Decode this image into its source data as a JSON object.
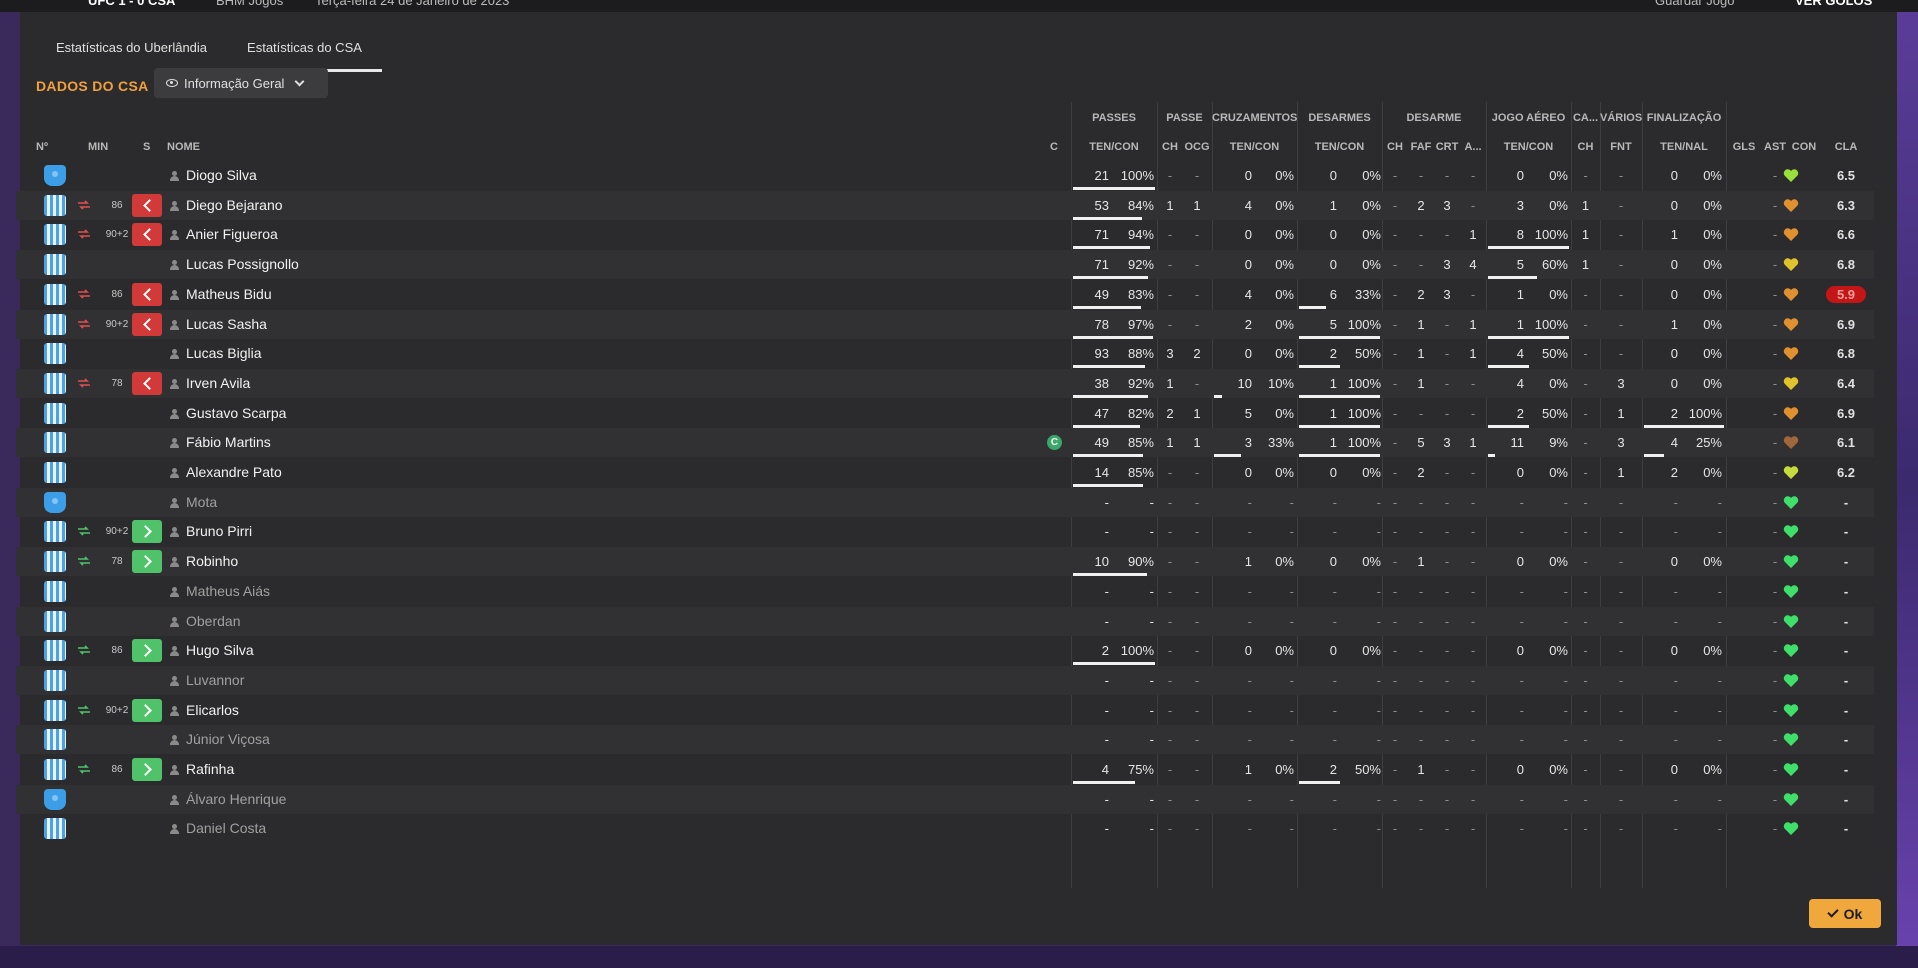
{
  "topbar": {
    "score": "UFC  1 - 0  CSA",
    "channel": "BHM Jogos",
    "date": "Terça-feira 24 de Janeiro de 2023",
    "save_label": "Guardar Jogo",
    "goals_label": "VER GOLOS"
  },
  "tabs": [
    {
      "label": "Estatísticas do Uberlândia",
      "active": false
    },
    {
      "label": "Estatísticas do CSA",
      "active": true
    }
  ],
  "team_title": "DADOS DO CSA",
  "view_dropdown": {
    "selected": "Informação Geral"
  },
  "groups": {
    "passes": "PASSES",
    "passe": "PASSE",
    "cruzamentos": "CRUZAMENTOS",
    "desarmes": "DESARMES",
    "desarme": "DESARME",
    "jogo_aereo": "JOGO AÉREO",
    "ca": "CA...",
    "varios": "VÁRIOS",
    "finalizacao": "FINALIZAÇÃO"
  },
  "subheaders": {
    "num": "Nº",
    "min": "MIN",
    "s": "S",
    "nome": "NOME",
    "c": "C",
    "passes": "TEN/CON",
    "passe_ch": "CH",
    "passe_ocg": "OCG",
    "cruz": "TEN/CON",
    "des": "TEN/CON",
    "desarme_ch": "CH",
    "faf": "FAF",
    "crt": "CRT",
    "a": "A...",
    "aereo": "TEN/CON",
    "ca_ch": "CH",
    "fnt": "FNT",
    "fin": "TEN/NAL",
    "gls": "GLS",
    "ast": "AST",
    "con": "CON",
    "cla": "CLA"
  },
  "colors": {
    "accent": "#f0a03c",
    "sub_out": "#d23a3a",
    "sub_in": "#4fc26a",
    "bad_rating": "#c41616"
  },
  "players": [
    {
      "kit": "gk",
      "min": "",
      "sub": "",
      "name": "Diogo Silva",
      "unused": false,
      "captain": false,
      "p": [
        "21",
        "100%"
      ],
      "pa": [
        "-",
        "-"
      ],
      "cr": [
        "0",
        "0%"
      ],
      "de": [
        "0",
        "0%"
      ],
      "ds": [
        "-",
        "-",
        "-",
        "-"
      ],
      "ae": [
        "0",
        "0%"
      ],
      "ca": "-",
      "fnt": "-",
      "fi": [
        "0",
        "0%"
      ],
      "gls": "",
      "ast": "-",
      "con": "green-yellow",
      "cla": "6.5",
      "bad": false,
      "bars": {
        "p": 1.0
      }
    },
    {
      "kit": "field",
      "min": "86",
      "sub": "out",
      "name": "Diego Bejarano",
      "unused": false,
      "captain": false,
      "p": [
        "53",
        "84%"
      ],
      "pa": [
        "1",
        "1"
      ],
      "cr": [
        "4",
        "0%"
      ],
      "de": [
        "1",
        "0%"
      ],
      "ds": [
        "-",
        "2",
        "3",
        "-"
      ],
      "ae": [
        "3",
        "0%"
      ],
      "ca": "1",
      "fnt": "-",
      "fi": [
        "0",
        "0%"
      ],
      "gls": "",
      "ast": "-",
      "con": "orange",
      "cla": "6.3",
      "bad": false,
      "bars": {
        "p": 0.84
      }
    },
    {
      "kit": "field",
      "min": "90+2",
      "sub": "out",
      "name": "Anier Figueroa",
      "unused": false,
      "captain": false,
      "p": [
        "71",
        "94%"
      ],
      "pa": [
        "-",
        "-"
      ],
      "cr": [
        "0",
        "0%"
      ],
      "de": [
        "0",
        "0%"
      ],
      "ds": [
        "-",
        "-",
        "-",
        "1"
      ],
      "ae": [
        "8",
        "100%"
      ],
      "ca": "1",
      "fnt": "-",
      "fi": [
        "1",
        "0%"
      ],
      "gls": "",
      "ast": "-",
      "con": "orange",
      "cla": "6.6",
      "bad": false,
      "bars": {
        "p": 0.94,
        "ae": 1.0
      }
    },
    {
      "kit": "field",
      "min": "",
      "sub": "",
      "name": "Lucas Possignollo",
      "unused": false,
      "captain": false,
      "p": [
        "71",
        "92%"
      ],
      "pa": [
        "-",
        "-"
      ],
      "cr": [
        "0",
        "0%"
      ],
      "de": [
        "0",
        "0%"
      ],
      "ds": [
        "-",
        "-",
        "3",
        "4"
      ],
      "ae": [
        "5",
        "60%"
      ],
      "ca": "1",
      "fnt": "-",
      "fi": [
        "0",
        "0%"
      ],
      "gls": "",
      "ast": "-",
      "con": "yellow",
      "cla": "6.8",
      "bad": false,
      "bars": {
        "p": 0.92,
        "ae": 0.6
      }
    },
    {
      "kit": "field",
      "min": "86",
      "sub": "out",
      "name": "Matheus Bidu",
      "unused": false,
      "captain": false,
      "p": [
        "49",
        "83%"
      ],
      "pa": [
        "-",
        "-"
      ],
      "cr": [
        "4",
        "0%"
      ],
      "de": [
        "6",
        "33%"
      ],
      "ds": [
        "-",
        "2",
        "3",
        "-"
      ],
      "ae": [
        "1",
        "0%"
      ],
      "ca": "-",
      "fnt": "-",
      "fi": [
        "0",
        "0%"
      ],
      "gls": "",
      "ast": "-",
      "con": "orange",
      "cla": "5.9",
      "bad": true,
      "bars": {
        "p": 0.83,
        "de": 0.33
      }
    },
    {
      "kit": "field",
      "min": "90+2",
      "sub": "out",
      "name": "Lucas Sasha",
      "unused": false,
      "captain": false,
      "p": [
        "78",
        "97%"
      ],
      "pa": [
        "-",
        "-"
      ],
      "cr": [
        "2",
        "0%"
      ],
      "de": [
        "5",
        "100%"
      ],
      "ds": [
        "-",
        "1",
        "-",
        "1"
      ],
      "ae": [
        "1",
        "100%"
      ],
      "ca": "-",
      "fnt": "-",
      "fi": [
        "1",
        "0%"
      ],
      "gls": "",
      "ast": "-",
      "con": "orange",
      "cla": "6.9",
      "bad": false,
      "bars": {
        "p": 0.97,
        "de": 1.0,
        "ae": 1.0
      }
    },
    {
      "kit": "field",
      "min": "",
      "sub": "",
      "name": "Lucas Biglia",
      "unused": false,
      "captain": false,
      "p": [
        "93",
        "88%"
      ],
      "pa": [
        "3",
        "2"
      ],
      "cr": [
        "0",
        "0%"
      ],
      "de": [
        "2",
        "50%"
      ],
      "ds": [
        "-",
        "1",
        "-",
        "1"
      ],
      "ae": [
        "4",
        "50%"
      ],
      "ca": "-",
      "fnt": "-",
      "fi": [
        "0",
        "0%"
      ],
      "gls": "",
      "ast": "-",
      "con": "orange",
      "cla": "6.8",
      "bad": false,
      "bars": {
        "p": 0.88,
        "de": 0.5,
        "ae": 0.5
      }
    },
    {
      "kit": "field",
      "min": "78",
      "sub": "out",
      "name": "Irven Avila",
      "unused": false,
      "captain": false,
      "p": [
        "38",
        "92%"
      ],
      "pa": [
        "1",
        "-"
      ],
      "cr": [
        "10",
        "10%"
      ],
      "de": [
        "1",
        "100%"
      ],
      "ds": [
        "-",
        "1",
        "-",
        "-"
      ],
      "ae": [
        "4",
        "0%"
      ],
      "ca": "-",
      "fnt": "3",
      "fi": [
        "0",
        "0%"
      ],
      "gls": "",
      "ast": "-",
      "con": "yellow",
      "cla": "6.4",
      "bad": false,
      "bars": {
        "p": 0.92,
        "cr": 0.1,
        "de": 1.0
      }
    },
    {
      "kit": "field",
      "min": "",
      "sub": "",
      "name": "Gustavo Scarpa",
      "unused": false,
      "captain": false,
      "p": [
        "47",
        "82%"
      ],
      "pa": [
        "2",
        "1"
      ],
      "cr": [
        "5",
        "0%"
      ],
      "de": [
        "1",
        "100%"
      ],
      "ds": [
        "-",
        "-",
        "-",
        "-"
      ],
      "ae": [
        "2",
        "50%"
      ],
      "ca": "-",
      "fnt": "1",
      "fi": [
        "2",
        "100%"
      ],
      "gls": "",
      "ast": "-",
      "con": "orange",
      "cla": "6.9",
      "bad": false,
      "bars": {
        "p": 0.82,
        "de": 1.0,
        "ae": 0.5,
        "fi": 1.0
      }
    },
    {
      "kit": "field",
      "min": "",
      "sub": "",
      "name": "Fábio Martins",
      "unused": false,
      "captain": true,
      "p": [
        "49",
        "85%"
      ],
      "pa": [
        "1",
        "1"
      ],
      "cr": [
        "3",
        "33%"
      ],
      "de": [
        "1",
        "100%"
      ],
      "ds": [
        "-",
        "5",
        "3",
        "1"
      ],
      "ae": [
        "11",
        "9%"
      ],
      "ca": "-",
      "fnt": "3",
      "fi": [
        "4",
        "25%"
      ],
      "gls": "",
      "ast": "-",
      "con": "brown",
      "cla": "6.1",
      "bad": false,
      "bars": {
        "p": 0.85,
        "cr": 0.33,
        "de": 1.0,
        "ae": 0.09,
        "fi": 0.25
      }
    },
    {
      "kit": "field",
      "min": "",
      "sub": "",
      "name": "Alexandre Pato",
      "unused": false,
      "captain": false,
      "p": [
        "14",
        "85%"
      ],
      "pa": [
        "-",
        "-"
      ],
      "cr": [
        "0",
        "0%"
      ],
      "de": [
        "0",
        "0%"
      ],
      "ds": [
        "-",
        "2",
        "-",
        "-"
      ],
      "ae": [
        "0",
        "0%"
      ],
      "ca": "-",
      "fnt": "1",
      "fi": [
        "2",
        "0%"
      ],
      "gls": "",
      "ast": "-",
      "con": "yellow-green",
      "cla": "6.2",
      "bad": false,
      "bars": {
        "p": 0.85
      }
    },
    {
      "kit": "gk",
      "min": "",
      "sub": "",
      "name": "Mota",
      "unused": true,
      "captain": false,
      "p": [
        "-",
        "-"
      ],
      "pa": [
        "-",
        "-"
      ],
      "cr": [
        "-",
        "-"
      ],
      "de": [
        "-",
        "-"
      ],
      "ds": [
        "-",
        "-",
        "-",
        "-"
      ],
      "ae": [
        "-",
        "-"
      ],
      "ca": "-",
      "fnt": "-",
      "fi": [
        "-",
        "-"
      ],
      "gls": "",
      "ast": "-",
      "con": "green",
      "cla": "-",
      "bad": false,
      "bars": {}
    },
    {
      "kit": "field",
      "min": "90+2",
      "sub": "in",
      "name": "Bruno Pirri",
      "unused": false,
      "captain": false,
      "p": [
        "-",
        "-"
      ],
      "pa": [
        "-",
        "-"
      ],
      "cr": [
        "-",
        "-"
      ],
      "de": [
        "-",
        "-"
      ],
      "ds": [
        "-",
        "-",
        "-",
        "-"
      ],
      "ae": [
        "-",
        "-"
      ],
      "ca": "-",
      "fnt": "-",
      "fi": [
        "-",
        "-"
      ],
      "gls": "",
      "ast": "-",
      "con": "green",
      "cla": "-",
      "bad": false,
      "bars": {}
    },
    {
      "kit": "field",
      "min": "78",
      "sub": "in",
      "name": "Robinho",
      "unused": false,
      "captain": false,
      "p": [
        "10",
        "90%"
      ],
      "pa": [
        "-",
        "-"
      ],
      "cr": [
        "1",
        "0%"
      ],
      "de": [
        "0",
        "0%"
      ],
      "ds": [
        "-",
        "1",
        "-",
        "-"
      ],
      "ae": [
        "0",
        "0%"
      ],
      "ca": "-",
      "fnt": "-",
      "fi": [
        "0",
        "0%"
      ],
      "gls": "",
      "ast": "-",
      "con": "green",
      "cla": "-",
      "bad": false,
      "bars": {
        "p": 0.9
      }
    },
    {
      "kit": "field",
      "min": "",
      "sub": "",
      "name": "Matheus Aiás",
      "unused": true,
      "captain": false,
      "p": [
        "-",
        "-"
      ],
      "pa": [
        "-",
        "-"
      ],
      "cr": [
        "-",
        "-"
      ],
      "de": [
        "-",
        "-"
      ],
      "ds": [
        "-",
        "-",
        "-",
        "-"
      ],
      "ae": [
        "-",
        "-"
      ],
      "ca": "-",
      "fnt": "-",
      "fi": [
        "-",
        "-"
      ],
      "gls": "",
      "ast": "-",
      "con": "green",
      "cla": "-",
      "bad": false,
      "bars": {}
    },
    {
      "kit": "field",
      "min": "",
      "sub": "",
      "name": "Oberdan",
      "unused": true,
      "captain": false,
      "p": [
        "-",
        "-"
      ],
      "pa": [
        "-",
        "-"
      ],
      "cr": [
        "-",
        "-"
      ],
      "de": [
        "-",
        "-"
      ],
      "ds": [
        "-",
        "-",
        "-",
        "-"
      ],
      "ae": [
        "-",
        "-"
      ],
      "ca": "-",
      "fnt": "-",
      "fi": [
        "-",
        "-"
      ],
      "gls": "",
      "ast": "-",
      "con": "green",
      "cla": "-",
      "bad": false,
      "bars": {}
    },
    {
      "kit": "field",
      "min": "86",
      "sub": "in",
      "name": "Hugo Silva",
      "unused": false,
      "captain": false,
      "p": [
        "2",
        "100%"
      ],
      "pa": [
        "-",
        "-"
      ],
      "cr": [
        "0",
        "0%"
      ],
      "de": [
        "0",
        "0%"
      ],
      "ds": [
        "-",
        "-",
        "-",
        "-"
      ],
      "ae": [
        "0",
        "0%"
      ],
      "ca": "-",
      "fnt": "-",
      "fi": [
        "0",
        "0%"
      ],
      "gls": "",
      "ast": "-",
      "con": "green",
      "cla": "-",
      "bad": false,
      "bars": {
        "p": 1.0
      }
    },
    {
      "kit": "field",
      "min": "",
      "sub": "",
      "name": "Luvannor",
      "unused": true,
      "captain": false,
      "p": [
        "-",
        "-"
      ],
      "pa": [
        "-",
        "-"
      ],
      "cr": [
        "-",
        "-"
      ],
      "de": [
        "-",
        "-"
      ],
      "ds": [
        "-",
        "-",
        "-",
        "-"
      ],
      "ae": [
        "-",
        "-"
      ],
      "ca": "-",
      "fnt": "-",
      "fi": [
        "-",
        "-"
      ],
      "gls": "",
      "ast": "-",
      "con": "green",
      "cla": "-",
      "bad": false,
      "bars": {}
    },
    {
      "kit": "field",
      "min": "90+2",
      "sub": "in",
      "name": "Elicarlos",
      "unused": false,
      "captain": false,
      "p": [
        "-",
        "-"
      ],
      "pa": [
        "-",
        "-"
      ],
      "cr": [
        "-",
        "-"
      ],
      "de": [
        "-",
        "-"
      ],
      "ds": [
        "-",
        "-",
        "-",
        "-"
      ],
      "ae": [
        "-",
        "-"
      ],
      "ca": "-",
      "fnt": "-",
      "fi": [
        "-",
        "-"
      ],
      "gls": "",
      "ast": "-",
      "con": "green",
      "cla": "-",
      "bad": false,
      "bars": {}
    },
    {
      "kit": "field",
      "min": "",
      "sub": "",
      "name": "Júnior Viçosa",
      "unused": true,
      "captain": false,
      "p": [
        "-",
        "-"
      ],
      "pa": [
        "-",
        "-"
      ],
      "cr": [
        "-",
        "-"
      ],
      "de": [
        "-",
        "-"
      ],
      "ds": [
        "-",
        "-",
        "-",
        "-"
      ],
      "ae": [
        "-",
        "-"
      ],
      "ca": "-",
      "fnt": "-",
      "fi": [
        "-",
        "-"
      ],
      "gls": "",
      "ast": "-",
      "con": "green",
      "cla": "-",
      "bad": false,
      "bars": {}
    },
    {
      "kit": "field",
      "min": "86",
      "sub": "in",
      "name": "Rafinha",
      "unused": false,
      "captain": false,
      "p": [
        "4",
        "75%"
      ],
      "pa": [
        "-",
        "-"
      ],
      "cr": [
        "1",
        "0%"
      ],
      "de": [
        "2",
        "50%"
      ],
      "ds": [
        "-",
        "1",
        "-",
        "-"
      ],
      "ae": [
        "0",
        "0%"
      ],
      "ca": "-",
      "fnt": "-",
      "fi": [
        "0",
        "0%"
      ],
      "gls": "",
      "ast": "-",
      "con": "green",
      "cla": "-",
      "bad": false,
      "bars": {
        "p": 0.75,
        "de": 0.5
      }
    },
    {
      "kit": "gk",
      "min": "",
      "sub": "",
      "name": "Álvaro Henrique",
      "unused": true,
      "captain": false,
      "p": [
        "-",
        "-"
      ],
      "pa": [
        "-",
        "-"
      ],
      "cr": [
        "-",
        "-"
      ],
      "de": [
        "-",
        "-"
      ],
      "ds": [
        "-",
        "-",
        "-",
        "-"
      ],
      "ae": [
        "-",
        "-"
      ],
      "ca": "-",
      "fnt": "-",
      "fi": [
        "-",
        "-"
      ],
      "gls": "",
      "ast": "-",
      "con": "green",
      "cla": "-",
      "bad": false,
      "bars": {}
    },
    {
      "kit": "field",
      "min": "",
      "sub": "",
      "name": "Daniel Costa",
      "unused": true,
      "captain": false,
      "p": [
        "-",
        "-"
      ],
      "pa": [
        "-",
        "-"
      ],
      "cr": [
        "-",
        "-"
      ],
      "de": [
        "-",
        "-"
      ],
      "ds": [
        "-",
        "-",
        "-",
        "-"
      ],
      "ae": [
        "-",
        "-"
      ],
      "ca": "-",
      "fnt": "-",
      "fi": [
        "-",
        "-"
      ],
      "gls": "",
      "ast": "-",
      "con": "green",
      "cla": "-",
      "bad": false,
      "bars": {}
    }
  ],
  "captain_badge": "C",
  "ok_label": "Ok"
}
